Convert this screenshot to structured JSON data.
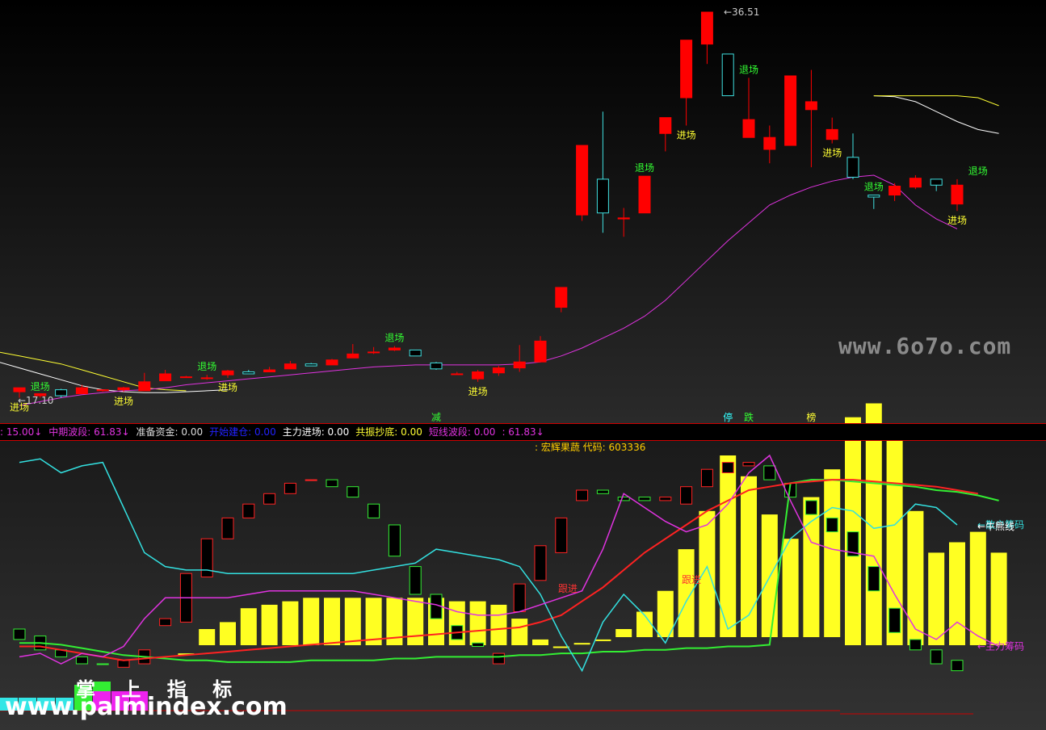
{
  "chart_data": [
    {
      "type": "candlestick",
      "price_labels": {
        "high": "36.51",
        "low": "17.10"
      },
      "candles": [
        [
          17.4,
          17.6,
          17.1,
          17.45
        ],
        [
          17.2,
          17.3,
          17.1,
          17.25
        ],
        [
          17.5,
          17.2,
          17.1,
          17.55
        ],
        [
          17.3,
          17.6,
          17.3,
          17.75
        ],
        [
          17.45,
          17.5,
          17.4,
          17.5
        ],
        [
          17.5,
          17.6,
          17.4,
          17.65
        ],
        [
          17.45,
          17.9,
          17.45,
          18.35
        ],
        [
          17.95,
          18.3,
          17.95,
          18.5
        ],
        [
          18.15,
          18.15,
          18.1,
          18.2
        ],
        [
          18.1,
          18.1,
          18.0,
          18.25
        ],
        [
          18.25,
          18.45,
          18.1,
          18.5
        ],
        [
          18.4,
          18.3,
          18.3,
          18.5
        ],
        [
          18.4,
          18.5,
          18.4,
          18.65
        ],
        [
          18.55,
          18.8,
          18.55,
          18.95
        ],
        [
          18.8,
          18.7,
          18.7,
          18.85
        ],
        [
          18.75,
          19.0,
          18.75,
          19.05
        ],
        [
          19.1,
          19.3,
          19.1,
          19.8
        ],
        [
          19.4,
          19.4,
          19.3,
          19.65
        ],
        [
          19.5,
          19.6,
          19.45,
          19.7
        ],
        [
          19.5,
          19.2,
          19.2,
          19.3
        ],
        [
          18.85,
          18.55,
          18.5,
          18.9
        ],
        [
          18.3,
          18.3,
          18.25,
          18.4
        ],
        [
          18.05,
          18.4,
          17.9,
          18.5
        ],
        [
          18.35,
          18.6,
          18.2,
          18.7
        ],
        [
          18.6,
          18.9,
          18.4,
          19.75
        ],
        [
          18.9,
          19.95,
          18.9,
          20.2
        ],
        [
          21.65,
          22.65,
          21.4,
          22.65
        ],
        [
          26.3,
          29.8,
          26.0,
          29.8
        ],
        [
          28.1,
          26.4,
          25.4,
          31.5
        ],
        [
          26.1,
          26.15,
          25.2,
          26.65
        ],
        [
          26.4,
          28.25,
          26.4,
          28.25
        ],
        [
          30.4,
          31.2,
          29.5,
          31.2
        ],
        [
          32.2,
          35.1,
          30.8,
          35.1
        ],
        [
          34.9,
          36.51,
          33.9,
          36.51
        ],
        [
          34.4,
          32.3,
          32.3,
          34.4
        ],
        [
          30.2,
          31.1,
          31.1,
          33.2
        ],
        [
          29.6,
          30.2,
          28.9,
          30.8
        ],
        [
          29.8,
          33.3,
          29.8,
          33.3
        ],
        [
          31.6,
          32.0,
          28.7,
          33.6
        ],
        [
          30.1,
          30.6,
          29.9,
          31.2
        ],
        [
          29.2,
          28.2,
          28.1,
          30.4
        ],
        [
          27.3,
          27.2,
          26.6,
          27.3
        ],
        [
          27.3,
          27.75,
          27.0,
          27.9
        ],
        [
          27.7,
          28.15,
          27.6,
          28.3
        ],
        [
          28.1,
          27.8,
          27.5,
          28.0
        ],
        [
          26.85,
          27.8,
          26.5,
          28.1
        ]
      ],
      "ma_purple": [
        16.7,
        16.9,
        17.1,
        17.25,
        17.35,
        17.45,
        17.5,
        17.6,
        17.75,
        17.85,
        17.95,
        18.05,
        18.15,
        18.25,
        18.35,
        18.45,
        18.55,
        18.65,
        18.7,
        18.75,
        18.75,
        18.75,
        18.75,
        18.75,
        18.8,
        18.9,
        19.2,
        19.6,
        20.1,
        20.6,
        21.2,
        22.0,
        23.0,
        24.0,
        25.0,
        25.9,
        26.8,
        27.3,
        27.7,
        28.0,
        28.2,
        28.3,
        27.8,
        26.8,
        26.1,
        25.6
      ],
      "ma_white_start": [
        18.9,
        18.6,
        18.3,
        18.0,
        17.7,
        17.5,
        17.4,
        17.35,
        17.35,
        17.4,
        17.45,
        17.5
      ],
      "ma_white_end": [
        32.3,
        32.25,
        32.0,
        31.5,
        31.0,
        30.6,
        30.4
      ],
      "ma_yellow_start": [
        19.4,
        19.2,
        19.0,
        18.8,
        18.5,
        18.2,
        17.9,
        17.6,
        17.5,
        17.45
      ],
      "ma_yellow_end": [
        32.3,
        32.3,
        32.3,
        32.3,
        32.3,
        32.2,
        31.8
      ],
      "signals": [
        {
          "i": 0,
          "text": "进场",
          "color": "#ffff33",
          "pos": "below"
        },
        {
          "i": 1,
          "text": "退场",
          "color": "#33ff33",
          "pos": "above"
        },
        {
          "i": 5,
          "text": "进场",
          "color": "#ffff33",
          "pos": "below"
        },
        {
          "i": 9,
          "text": "退场",
          "color": "#33ff33",
          "pos": "above"
        },
        {
          "i": 10,
          "text": "进场",
          "color": "#ffff33",
          "pos": "below"
        },
        {
          "i": 18,
          "text": "退场",
          "color": "#33ff33",
          "pos": "above"
        },
        {
          "i": 22,
          "text": "进场",
          "color": "#ffff33",
          "pos": "below"
        },
        {
          "i": 30,
          "text": "退场",
          "color": "#33ff33",
          "pos": "above"
        },
        {
          "i": 32,
          "text": "进场",
          "color": "#ffff33",
          "pos": "below"
        },
        {
          "i": 35,
          "text": "退场",
          "color": "#33ff33",
          "pos": "above"
        },
        {
          "i": 39,
          "text": "进场",
          "color": "#ffff33",
          "pos": "below"
        },
        {
          "i": 41,
          "text": "退场",
          "color": "#33ff33",
          "pos": "above"
        },
        {
          "i": 45,
          "text": "进场",
          "color": "#ffff33",
          "pos": "below"
        },
        {
          "i": 46,
          "text": "退场",
          "color": "#33ff33",
          "pos": "above"
        }
      ],
      "markers": [
        {
          "i": 20,
          "text": "减",
          "color": "#33ff33"
        },
        {
          "i": 34,
          "text": "停",
          "color": "#33ffff"
        },
        {
          "i": 35,
          "text": "跌",
          "color": "#33ff33"
        },
        {
          "i": 38,
          "text": "榜",
          "color": "#ffff33"
        }
      ]
    },
    {
      "type": "indicator",
      "series_labels": [
        "散户筹码",
        "牛熊线",
        "主力筹码"
      ],
      "text_labels": [
        "跟进",
        "跟进"
      ],
      "cyan": [
        58,
        59,
        55,
        57,
        58,
        45,
        32,
        28,
        27,
        27,
        26,
        26,
        26,
        26,
        26,
        26,
        26,
        27,
        28,
        29,
        33,
        32,
        31,
        30,
        28,
        20,
        8,
        -2,
        12,
        20,
        14,
        6,
        18,
        28,
        10,
        14,
        25,
        36,
        41,
        45,
        44,
        39,
        40,
        46,
        45,
        40
      ],
      "purple": [
        2,
        3,
        0,
        3,
        2,
        5,
        13,
        19,
        19,
        19,
        19,
        20,
        21,
        21,
        21,
        21,
        21,
        20,
        19,
        18,
        17,
        15,
        14,
        14,
        15,
        17,
        19,
        21,
        33,
        49,
        45,
        41,
        38,
        40,
        46,
        55,
        60,
        47,
        35,
        33,
        32,
        31,
        20,
        10,
        7,
        12,
        8,
        5
      ],
      "red": [
        5,
        5,
        4,
        3,
        2,
        1,
        1.5,
        2,
        2.5,
        3,
        3.5,
        4,
        4.5,
        5,
        5.5,
        6,
        6.5,
        7,
        7.5,
        8,
        8.5,
        9,
        9.5,
        10,
        10.5,
        12,
        14,
        18,
        22,
        27,
        32,
        36,
        40,
        44,
        47,
        50,
        51,
        52,
        52.5,
        53,
        53,
        52.5,
        52,
        51.5,
        51,
        50,
        49
      ],
      "green_line": [
        6,
        6,
        5.5,
        4.5,
        3.5,
        2.5,
        2,
        1.5,
        1,
        1,
        0.5,
        0.5,
        0.5,
        0.5,
        1,
        1,
        1,
        1,
        1.5,
        1.5,
        2,
        2,
        2,
        2,
        2.5,
        2.5,
        3,
        3,
        3.5,
        3.5,
        4,
        4,
        4.5,
        4.5,
        5,
        5,
        5.5,
        52,
        53,
        53,
        52.5,
        52,
        51.5,
        51,
        50,
        49.5,
        48.5,
        47
      ],
      "yellow_bars": [
        0,
        0,
        0,
        0,
        3,
        10,
        12,
        16,
        17,
        18,
        19,
        19,
        19,
        19,
        19,
        19,
        19,
        18,
        18,
        17,
        13,
        7,
        5,
        6,
        7,
        10,
        15,
        21,
        33,
        44,
        60,
        54,
        43,
        36,
        48,
        56,
        71,
        75,
        66,
        44,
        32,
        35,
        38,
        32
      ],
      "boxes": [
        [
          10,
          7,
          "g"
        ],
        [
          8,
          4,
          "g"
        ],
        [
          4,
          2,
          "g"
        ],
        [
          2,
          0,
          "g"
        ],
        [
          0,
          0,
          "g"
        ],
        [
          -1,
          1,
          "r"
        ],
        [
          4,
          0,
          "r"
        ],
        [
          11,
          13,
          "r"
        ],
        [
          26,
          12,
          "r"
        ],
        [
          36,
          25,
          "r"
        ],
        [
          42,
          36,
          "r"
        ],
        [
          46,
          42,
          "r"
        ],
        [
          49,
          46,
          "r"
        ],
        [
          52,
          49,
          "r"
        ],
        [
          53,
          53,
          "r"
        ],
        [
          53,
          51,
          "g"
        ],
        [
          51,
          48,
          "g"
        ],
        [
          46,
          42,
          "g"
        ],
        [
          40,
          31,
          "g"
        ],
        [
          28,
          20,
          "g"
        ],
        [
          20,
          13,
          "g"
        ],
        [
          11,
          7,
          "g"
        ],
        [
          6,
          5,
          "g"
        ],
        [
          3,
          0,
          "r"
        ],
        [
          23,
          15,
          "r"
        ],
        [
          34,
          24,
          "r"
        ],
        [
          42,
          32,
          "r"
        ],
        [
          50,
          47,
          "r"
        ],
        [
          50,
          49,
          "g"
        ],
        [
          48,
          47,
          "g"
        ],
        [
          48,
          47,
          "g"
        ],
        [
          48,
          47,
          "r"
        ],
        [
          51,
          46,
          "r"
        ],
        [
          56,
          51,
          "r"
        ],
        [
          58,
          55,
          "r"
        ],
        [
          58,
          57,
          "r"
        ],
        [
          57,
          53,
          "g"
        ],
        [
          52,
          48,
          "g"
        ],
        [
          47,
          43,
          "g"
        ],
        [
          42,
          38,
          "g"
        ],
        [
          38,
          31,
          "g"
        ],
        [
          28,
          21,
          "g"
        ],
        [
          16,
          9,
          "g"
        ],
        [
          7,
          4,
          "g"
        ],
        [
          4,
          0,
          "g"
        ],
        [
          1,
          -2,
          "g"
        ]
      ],
      "bottom_bars_cyan": [
        2,
        2,
        2,
        2,
        1
      ],
      "bottom_bars_green": [
        0,
        0,
        0,
        0,
        8,
        9
      ],
      "bottom_bars_magenta": [
        0,
        0,
        0,
        0,
        0,
        6,
        6,
        6
      ]
    }
  ],
  "colors": {
    "up": "#ff0000",
    "down": "#40e0e0",
    "purple_line": "#e033e0",
    "white_line": "#ffffff",
    "yellow_line": "#ffff33",
    "cyan_line": "#33e0e0",
    "red_line": "#ff2222",
    "green_line": "#33ee33",
    "bar_yellow": "#ffff22"
  },
  "infobar": [
    {
      "text": ": 15.00↓",
      "color": "#e033e0"
    },
    {
      "text": "中期波段: 61.83↓",
      "color": "#e033e0"
    },
    {
      "text": "准备资金: 0.00",
      "color": "#dddddd"
    },
    {
      "text": "开始建仓: 0.00",
      "color": "#2222ff"
    },
    {
      "text": "主力进场: 0.00",
      "color": "#ffffff"
    },
    {
      "text": "共振抄底: 0.00",
      "color": "#ffff33"
    },
    {
      "text": "短线波段: 0.00",
      "color": "#e033e0"
    },
    {
      "text": ": 61.83↓",
      "color": "#e033e0"
    }
  ],
  "stock_title": ": 宏辉果蔬 代码: 603336",
  "watermarks": {
    "site": "www.6o7o.com",
    "brand": "掌 上 指 标",
    "url": "www.palmindex.com"
  }
}
